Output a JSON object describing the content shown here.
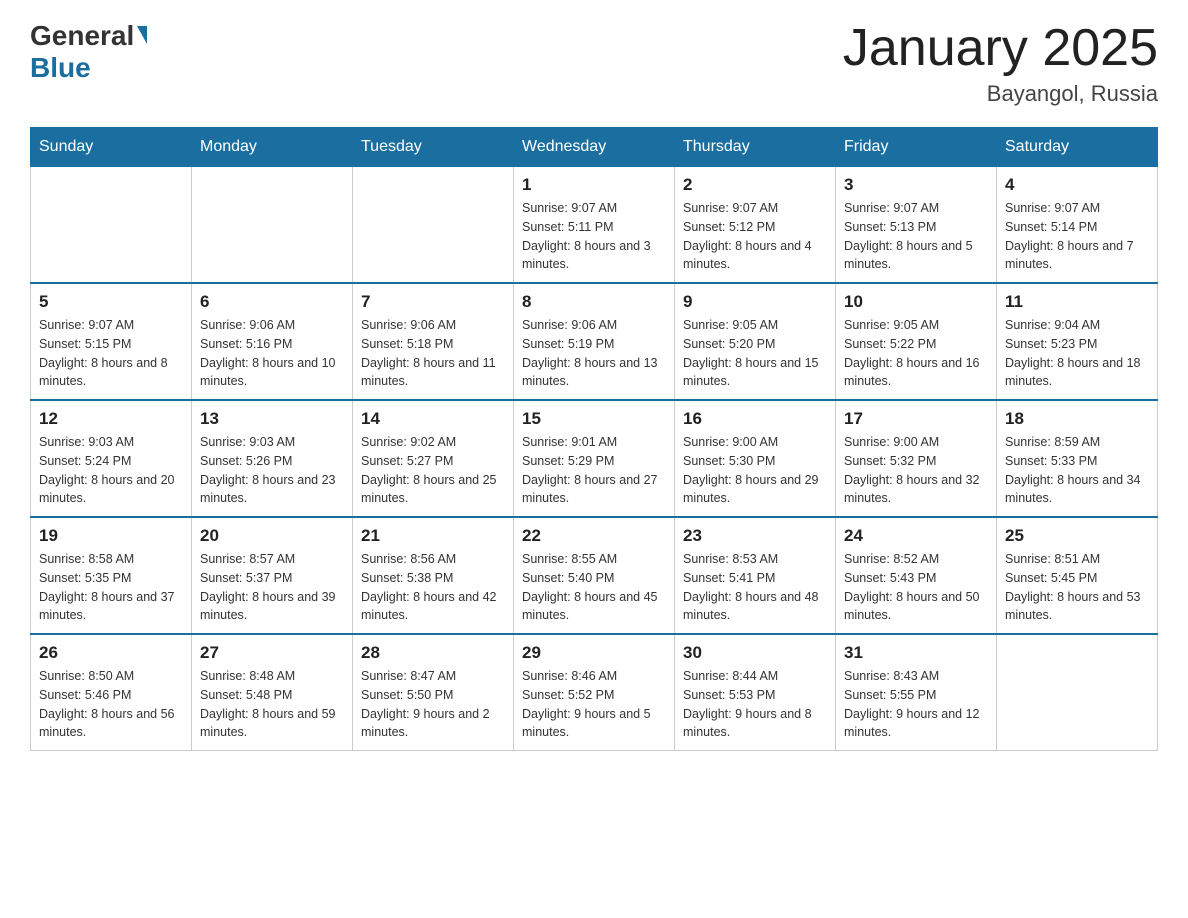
{
  "logo": {
    "general": "General",
    "blue": "Blue"
  },
  "title": "January 2025",
  "subtitle": "Bayangol, Russia",
  "days_of_week": [
    "Sunday",
    "Monday",
    "Tuesday",
    "Wednesday",
    "Thursday",
    "Friday",
    "Saturday"
  ],
  "weeks": [
    [
      null,
      null,
      null,
      {
        "day": "1",
        "sunrise": "Sunrise: 9:07 AM",
        "sunset": "Sunset: 5:11 PM",
        "daylight": "Daylight: 8 hours and 3 minutes."
      },
      {
        "day": "2",
        "sunrise": "Sunrise: 9:07 AM",
        "sunset": "Sunset: 5:12 PM",
        "daylight": "Daylight: 8 hours and 4 minutes."
      },
      {
        "day": "3",
        "sunrise": "Sunrise: 9:07 AM",
        "sunset": "Sunset: 5:13 PM",
        "daylight": "Daylight: 8 hours and 5 minutes."
      },
      {
        "day": "4",
        "sunrise": "Sunrise: 9:07 AM",
        "sunset": "Sunset: 5:14 PM",
        "daylight": "Daylight: 8 hours and 7 minutes."
      }
    ],
    [
      {
        "day": "5",
        "sunrise": "Sunrise: 9:07 AM",
        "sunset": "Sunset: 5:15 PM",
        "daylight": "Daylight: 8 hours and 8 minutes."
      },
      {
        "day": "6",
        "sunrise": "Sunrise: 9:06 AM",
        "sunset": "Sunset: 5:16 PM",
        "daylight": "Daylight: 8 hours and 10 minutes."
      },
      {
        "day": "7",
        "sunrise": "Sunrise: 9:06 AM",
        "sunset": "Sunset: 5:18 PM",
        "daylight": "Daylight: 8 hours and 11 minutes."
      },
      {
        "day": "8",
        "sunrise": "Sunrise: 9:06 AM",
        "sunset": "Sunset: 5:19 PM",
        "daylight": "Daylight: 8 hours and 13 minutes."
      },
      {
        "day": "9",
        "sunrise": "Sunrise: 9:05 AM",
        "sunset": "Sunset: 5:20 PM",
        "daylight": "Daylight: 8 hours and 15 minutes."
      },
      {
        "day": "10",
        "sunrise": "Sunrise: 9:05 AM",
        "sunset": "Sunset: 5:22 PM",
        "daylight": "Daylight: 8 hours and 16 minutes."
      },
      {
        "day": "11",
        "sunrise": "Sunrise: 9:04 AM",
        "sunset": "Sunset: 5:23 PM",
        "daylight": "Daylight: 8 hours and 18 minutes."
      }
    ],
    [
      {
        "day": "12",
        "sunrise": "Sunrise: 9:03 AM",
        "sunset": "Sunset: 5:24 PM",
        "daylight": "Daylight: 8 hours and 20 minutes."
      },
      {
        "day": "13",
        "sunrise": "Sunrise: 9:03 AM",
        "sunset": "Sunset: 5:26 PM",
        "daylight": "Daylight: 8 hours and 23 minutes."
      },
      {
        "day": "14",
        "sunrise": "Sunrise: 9:02 AM",
        "sunset": "Sunset: 5:27 PM",
        "daylight": "Daylight: 8 hours and 25 minutes."
      },
      {
        "day": "15",
        "sunrise": "Sunrise: 9:01 AM",
        "sunset": "Sunset: 5:29 PM",
        "daylight": "Daylight: 8 hours and 27 minutes."
      },
      {
        "day": "16",
        "sunrise": "Sunrise: 9:00 AM",
        "sunset": "Sunset: 5:30 PM",
        "daylight": "Daylight: 8 hours and 29 minutes."
      },
      {
        "day": "17",
        "sunrise": "Sunrise: 9:00 AM",
        "sunset": "Sunset: 5:32 PM",
        "daylight": "Daylight: 8 hours and 32 minutes."
      },
      {
        "day": "18",
        "sunrise": "Sunrise: 8:59 AM",
        "sunset": "Sunset: 5:33 PM",
        "daylight": "Daylight: 8 hours and 34 minutes."
      }
    ],
    [
      {
        "day": "19",
        "sunrise": "Sunrise: 8:58 AM",
        "sunset": "Sunset: 5:35 PM",
        "daylight": "Daylight: 8 hours and 37 minutes."
      },
      {
        "day": "20",
        "sunrise": "Sunrise: 8:57 AM",
        "sunset": "Sunset: 5:37 PM",
        "daylight": "Daylight: 8 hours and 39 minutes."
      },
      {
        "day": "21",
        "sunrise": "Sunrise: 8:56 AM",
        "sunset": "Sunset: 5:38 PM",
        "daylight": "Daylight: 8 hours and 42 minutes."
      },
      {
        "day": "22",
        "sunrise": "Sunrise: 8:55 AM",
        "sunset": "Sunset: 5:40 PM",
        "daylight": "Daylight: 8 hours and 45 minutes."
      },
      {
        "day": "23",
        "sunrise": "Sunrise: 8:53 AM",
        "sunset": "Sunset: 5:41 PM",
        "daylight": "Daylight: 8 hours and 48 minutes."
      },
      {
        "day": "24",
        "sunrise": "Sunrise: 8:52 AM",
        "sunset": "Sunset: 5:43 PM",
        "daylight": "Daylight: 8 hours and 50 minutes."
      },
      {
        "day": "25",
        "sunrise": "Sunrise: 8:51 AM",
        "sunset": "Sunset: 5:45 PM",
        "daylight": "Daylight: 8 hours and 53 minutes."
      }
    ],
    [
      {
        "day": "26",
        "sunrise": "Sunrise: 8:50 AM",
        "sunset": "Sunset: 5:46 PM",
        "daylight": "Daylight: 8 hours and 56 minutes."
      },
      {
        "day": "27",
        "sunrise": "Sunrise: 8:48 AM",
        "sunset": "Sunset: 5:48 PM",
        "daylight": "Daylight: 8 hours and 59 minutes."
      },
      {
        "day": "28",
        "sunrise": "Sunrise: 8:47 AM",
        "sunset": "Sunset: 5:50 PM",
        "daylight": "Daylight: 9 hours and 2 minutes."
      },
      {
        "day": "29",
        "sunrise": "Sunrise: 8:46 AM",
        "sunset": "Sunset: 5:52 PM",
        "daylight": "Daylight: 9 hours and 5 minutes."
      },
      {
        "day": "30",
        "sunrise": "Sunrise: 8:44 AM",
        "sunset": "Sunset: 5:53 PM",
        "daylight": "Daylight: 9 hours and 8 minutes."
      },
      {
        "day": "31",
        "sunrise": "Sunrise: 8:43 AM",
        "sunset": "Sunset: 5:55 PM",
        "daylight": "Daylight: 9 hours and 12 minutes."
      },
      null
    ]
  ]
}
